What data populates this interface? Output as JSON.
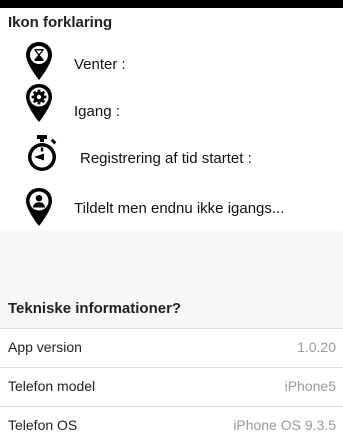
{
  "legend": {
    "title": "Ikon forklaring",
    "items": [
      {
        "icon": "hourglass-pin-icon",
        "label": "Venter :"
      },
      {
        "icon": "gear-pin-icon",
        "label": "Igang :"
      },
      {
        "icon": "stopwatch-icon",
        "label": "Registrering af tid startet :"
      },
      {
        "icon": "person-pin-icon",
        "label": "Tildelt men endnu ikke igangs..."
      }
    ]
  },
  "tech": {
    "title": "Tekniske informationer?",
    "rows": [
      {
        "key": "App version",
        "value": "1.0.20"
      },
      {
        "key": "Telefon model",
        "value": "iPhone5"
      },
      {
        "key": "Telefon OS",
        "value": "iPhone OS 9.3.5"
      }
    ]
  }
}
